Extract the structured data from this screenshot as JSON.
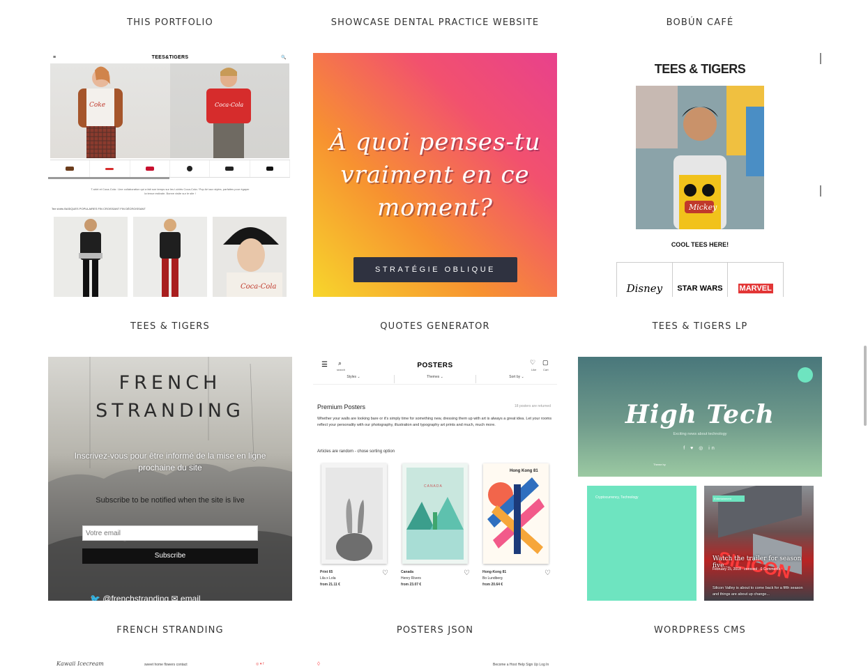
{
  "titles": {
    "row1": [
      "THIS PORTFOLIO",
      "SHOWCASE DENTAL PRACTICE WEBSITE",
      "BOBÚN CAFÉ"
    ],
    "row2": [
      "TEES & TIGERS",
      "QUOTES GENERATOR",
      "TEES & TIGERS LP"
    ],
    "row3": [
      "FRENCH STRANDING",
      "POSTERS JSON",
      "WORDPRESS CMS"
    ]
  },
  "card1": {
    "logo": "TEES&TIGERS",
    "menu_icon": "≡",
    "search": "🔍",
    "body_text": "T-shirt et Coca-Cola : Une collaboration qui a fait son temps sur les t-shirts Coca-Cola / Pop Art aux styles, parfaites pour égayer la tenue estivale. Bonne visite sur le site !",
    "nav": "Tee shirts   BASIQUES   POPULAIRES   FIN CROISSANT   FIN DÉCROISSANT"
  },
  "card2": {
    "quote": "À quoi penses-tu vraiment en ce moment?",
    "button": "STRATÉGIE OBLIQUE"
  },
  "card3": {
    "logo": "TEES & TIGERS",
    "tagline": "COOL TEES HERE!",
    "brands": [
      "Disney",
      "STAR WARS",
      "MARVEL"
    ]
  },
  "card4": {
    "title_line1": "FRENCH",
    "title_line2": "STRANDING",
    "subtitle": "Inscrivez-vous pour être informé de la mise en ligne prochaine du site",
    "subtitle_en": "Subscribe to be notified when the site is live",
    "email_placeholder": "Votre email",
    "subscribe": "Subscribe",
    "social": "🐦 @frenchstranding     ✉ email"
  },
  "card5": {
    "brand": "POSTERS",
    "search_label": "search",
    "like_label": "Like",
    "cart_label": "Cart",
    "filters": [
      "Styles ⌄",
      "Themes ⌄",
      "Sort by ⌄"
    ],
    "heading": "Premium Posters",
    "count": "18 posters are returned",
    "description": "Whether your walls are looking bare or it's simply time for something new, dressing them up with art is always a great idea. Let your rooms reflect your personality with our photography, illustration and typography art prints and much, much more.",
    "sort_note": "Articles are random - chose sorting option",
    "posters": [
      {
        "name": "Print 65",
        "artist": "Lila x Lola",
        "price": "from 21.11 €"
      },
      {
        "name": "Canada",
        "artist": "Henry Rivers",
        "price": "from 23.07 €"
      },
      {
        "name": "Hong-Kong 81",
        "artist": "Bo Lundberg",
        "price": "from 20.64 €"
      }
    ],
    "poster_canada_text": "CANADA",
    "poster_hk_text": "Hong Kong 81"
  },
  "card6": {
    "title": "High Tech",
    "subtitle": "Exciting news about technology",
    "icons": "f ♥ ◎ in",
    "theme_line": "Theme by",
    "article1_cat": "Cryptocurrency, Technology",
    "article2_tag": "Entertainment",
    "article2_title": "Watch the trailer for season five...",
    "article2_meta": "February 15, 2018   ·   zerocool   ·   0 Comments",
    "article2_excerpt": "Silicon Valley is about to come back for a fifth season and things are about up change..."
  },
  "row3": {
    "card1_logo": "Kawaii Icecream",
    "card1_nav": "sweet home    flowers    contact",
    "card3_nav": "Become a Host    Help    Sign Up    Log In"
  },
  "colors": {
    "accent_teal": "#6ee4c0",
    "button_dark": "#2f3240",
    "title_gray": "#333333"
  }
}
